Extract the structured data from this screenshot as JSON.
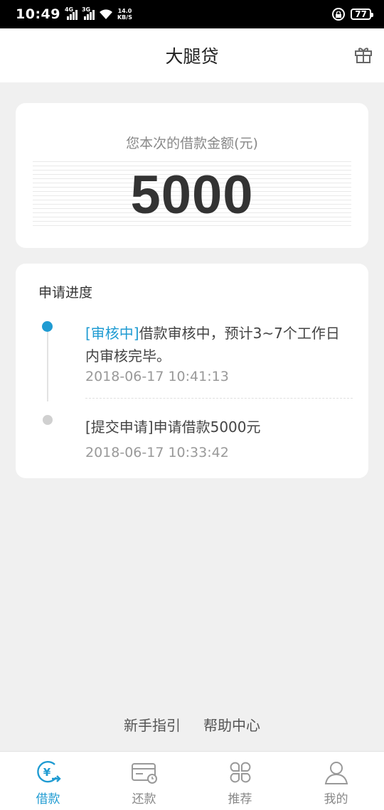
{
  "status_bar": {
    "time": "10:49",
    "signal_1_tag": "4G",
    "signal_2_tag": "3G",
    "net_speed_value": "14.0",
    "net_speed_unit": "KB/S",
    "battery": "77"
  },
  "header": {
    "title": "大腿贷",
    "right_icon": "gift-icon"
  },
  "amount_card": {
    "label": "您本次的借款金额(元)",
    "amount": "5000"
  },
  "progress": {
    "title": "申请进度",
    "items": [
      {
        "status": "[审核中]",
        "text": "借款审核中，预计3~7个工作日内审核完毕。",
        "time": "2018-06-17 10:41:13",
        "active": true
      },
      {
        "status": "[提交申请]",
        "text": "申请借款5000元",
        "time": "2018-06-17 10:33:42",
        "active": false
      }
    ]
  },
  "footer_links": {
    "guide": "新手指引",
    "help": "帮助中心"
  },
  "tabs": [
    {
      "label": "借款",
      "icon": "loan-icon",
      "active": true
    },
    {
      "label": "还款",
      "icon": "repay-icon",
      "active": false
    },
    {
      "label": "推荐",
      "icon": "recommend-icon",
      "active": false
    },
    {
      "label": "我的",
      "icon": "profile-icon",
      "active": false
    }
  ],
  "colors": {
    "accent": "#1f9bd2",
    "background": "#f0f0f0",
    "inactive": "#888888"
  }
}
